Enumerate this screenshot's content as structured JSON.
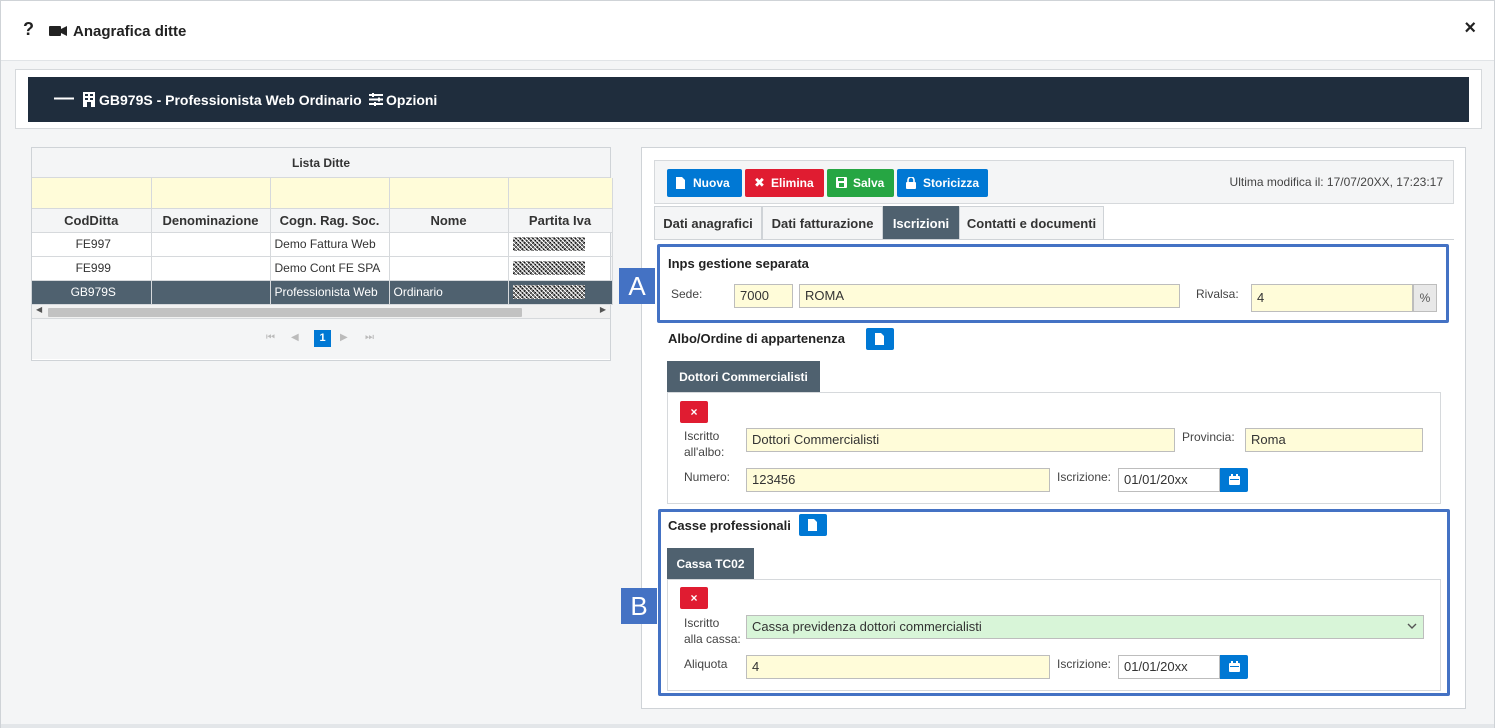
{
  "window": {
    "help_glyph": "?",
    "title": "Anagrafica ditte",
    "close_glyph": "×"
  },
  "header": {
    "collapse_glyph": "—",
    "company": "GB979S - Professionista Web Ordinario",
    "options": "Opzioni"
  },
  "grid": {
    "title": "Lista Ditte",
    "columns": [
      "CodDitta",
      "Denominazione",
      "Cogn. Rag. Soc.",
      "Nome",
      "Partita Iva"
    ],
    "rows": [
      {
        "cod": "FE997",
        "den": "",
        "cogn": "Demo Fattura Web",
        "nome": ""
      },
      {
        "cod": "FE999",
        "den": "",
        "cogn": "Demo Cont FE SPA",
        "nome": ""
      },
      {
        "cod": "GB979S",
        "den": "",
        "cogn": "Professionista Web",
        "nome": "Ordinario",
        "selected": true
      }
    ],
    "pager": {
      "first": "⏮",
      "prev": "◀",
      "current": "1",
      "next": "▶",
      "last": "⏭"
    }
  },
  "toolbar": {
    "new": "Nuova",
    "delete": "Elimina",
    "save": "Salva",
    "history": "Storicizza",
    "last_modified": "Ultima modifica il: 17/07/20XX, 17:23:17"
  },
  "tabs": [
    "Dati anagrafici",
    "Dati fatturazione",
    "Iscrizioni",
    "Contatti e documenti"
  ],
  "inps": {
    "title": "Inps gestione separata",
    "sede_label": "Sede:",
    "sede_code": "7000",
    "sede_name": "ROMA",
    "rivalsa_label": "Rivalsa:",
    "rivalsa_value": "4",
    "pct": "%"
  },
  "albo": {
    "title": "Albo/Ordine di appartenenza",
    "tab": "Dottori Commercialisti",
    "del": "×",
    "iscritto_label_1": "Iscritto",
    "iscritto_label_2": "all'albo:",
    "iscritto_value": "Dottori Commercialisti",
    "provincia_label": "Provincia:",
    "provincia_value": "Roma",
    "numero_label": "Numero:",
    "numero_value": "123456",
    "iscrizione_label": "Iscrizione:",
    "iscrizione_value": "01/01/20xx"
  },
  "casse": {
    "title": "Casse professionali",
    "tab": "Cassa TC02",
    "del": "×",
    "iscritto_label_1": "Iscritto",
    "iscritto_label_2": "alla cassa:",
    "iscritto_value": "Cassa previdenza dottori commercialisti",
    "aliquota_label": "Aliquota",
    "aliquota_value": "4",
    "iscrizione_label": "Iscrizione:",
    "iscrizione_value": "01/01/20xx"
  },
  "markers": {
    "a": "A",
    "b": "B"
  },
  "colors": {
    "primary": "#0078d4",
    "danger": "#e01c31",
    "success": "#26a643",
    "dark": "#1f2d3d",
    "highlight": "#4472c4"
  }
}
